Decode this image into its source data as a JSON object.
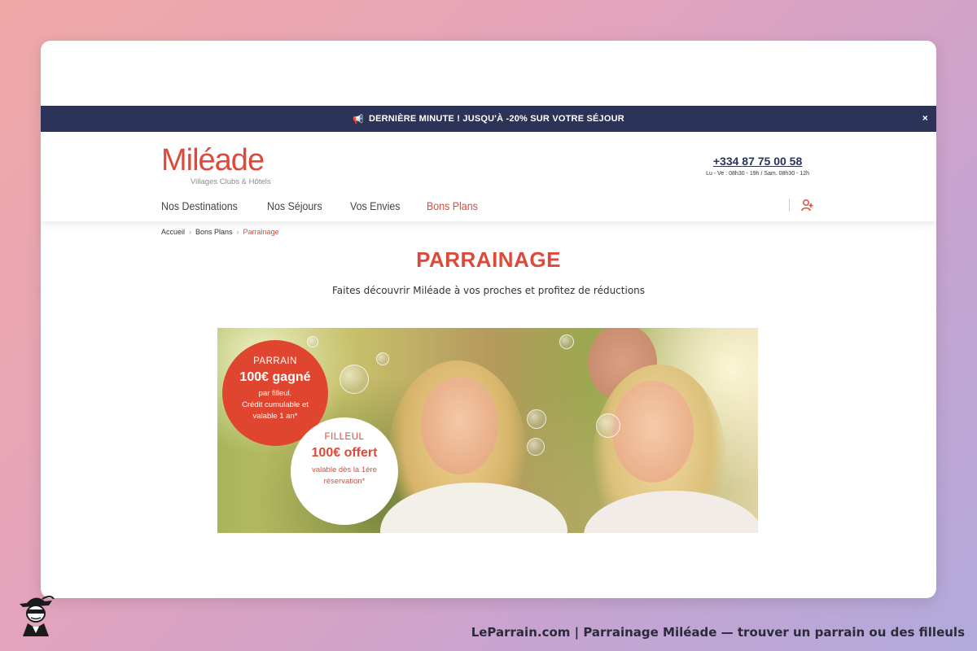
{
  "promo": {
    "text": "DERNIÈRE MINUTE ! JUSQU'À -20% SUR VOTRE SÉJOUR",
    "close": "×"
  },
  "logo": {
    "name": "Miléade",
    "tagline": "Villages Clubs & Hôtels"
  },
  "contact": {
    "phone": "+334 87 75 00 58",
    "hours": "Lu - Ve : 08h30 - 19h / Sam. 08h30 - 12h"
  },
  "nav": {
    "items": [
      {
        "label": "Nos Destinations"
      },
      {
        "label": "Nos Séjours"
      },
      {
        "label": "Vos Envies"
      },
      {
        "label": "Bons Plans"
      }
    ]
  },
  "breadcrumb": {
    "items": [
      "Accueil",
      "Bons Plans",
      "Parrainage"
    ]
  },
  "page": {
    "title": "PARRAINAGE",
    "subtitle": "Faites découvrir Miléade à vos proches et profitez de réductions"
  },
  "banner": {
    "parrain": {
      "label": "PARRAIN",
      "amount": "100€ gagné",
      "line1": "par filleul.",
      "line2": "Crédit cumulable et",
      "line3": "valable 1 an*"
    },
    "filleul": {
      "label": "FILLEUL",
      "amount": "100€ offert",
      "line1": "valable dès la 1ère",
      "line2": "réservation*"
    }
  },
  "footer": {
    "caption": "LeParrain.com | Parrainage Miléade — trouver un parrain ou des filleuls"
  },
  "colors": {
    "brand": "#de4a3a",
    "navy": "#2b3358"
  },
  "icons": {
    "megaphone": "megaphone-icon",
    "user": "user-icon",
    "close": "close-icon",
    "chevron": "chevron-right-icon"
  }
}
